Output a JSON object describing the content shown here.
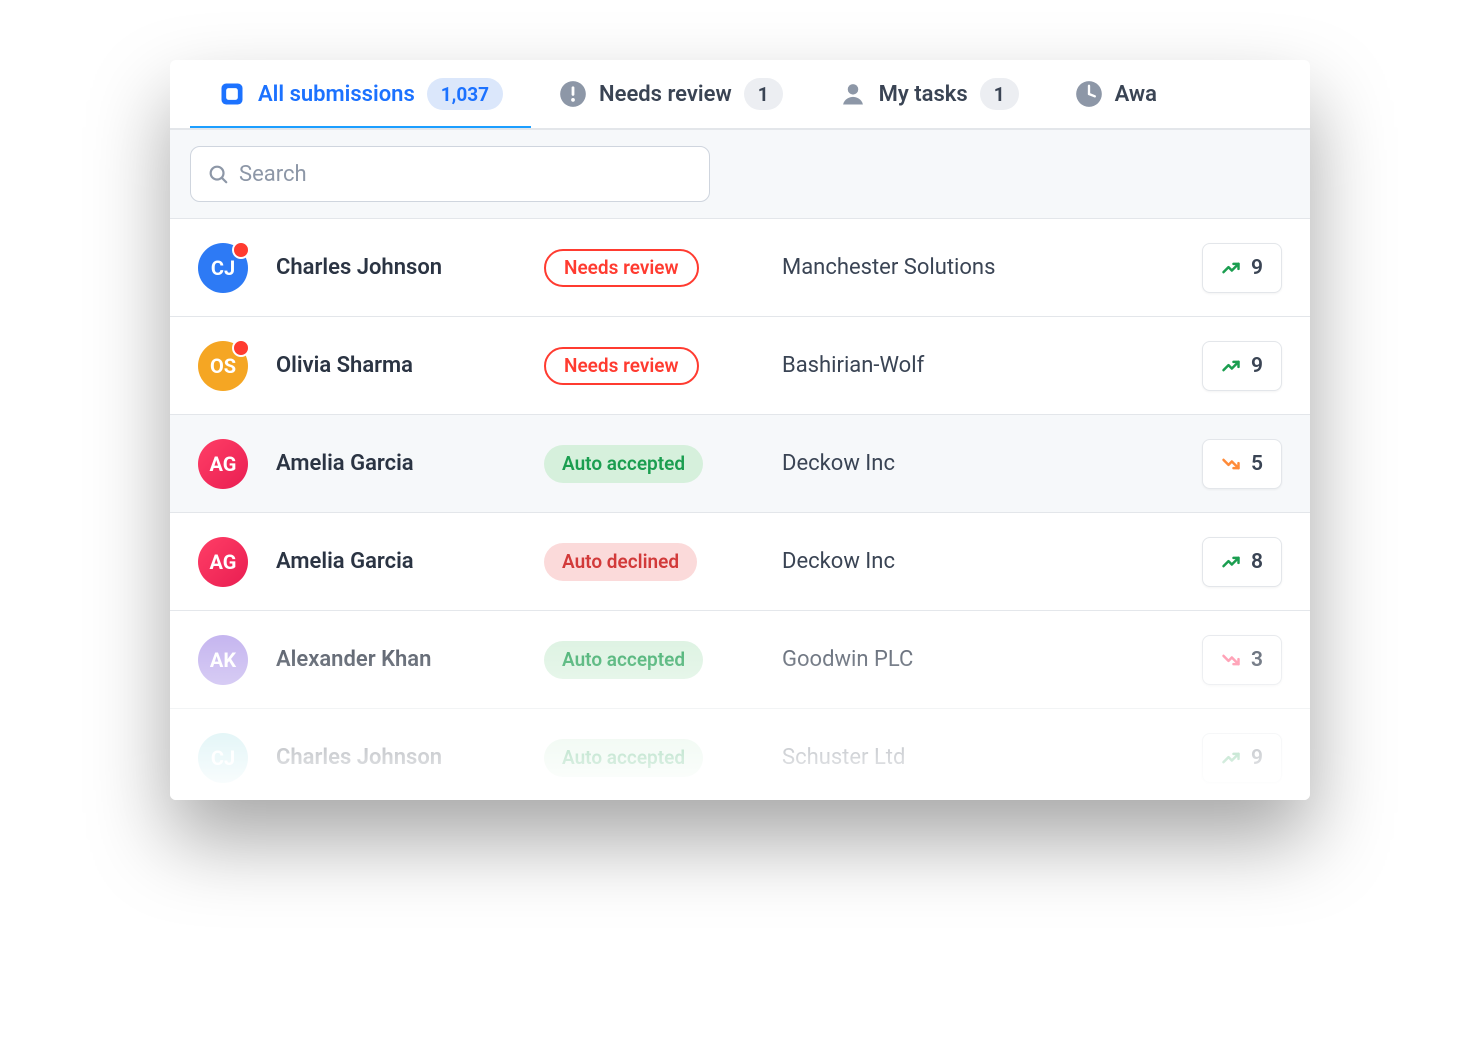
{
  "tabs": [
    {
      "icon": "inbox",
      "label": "All submissions",
      "count": "1,037",
      "active": true
    },
    {
      "icon": "alert",
      "label": "Needs review",
      "count": "1"
    },
    {
      "icon": "person",
      "label": "My tasks",
      "count": "1"
    },
    {
      "icon": "clock",
      "label": "Awa"
    }
  ],
  "search": {
    "placeholder": "Search",
    "value": ""
  },
  "rows": [
    {
      "initials": "CJ",
      "avatarColor": "c-blue",
      "dot": true,
      "name": "Charles Johnson",
      "status": "Needs review",
      "statusKind": "review",
      "company": "Manchester Solutions",
      "trend": "up",
      "score": "9",
      "alt": false
    },
    {
      "initials": "OS",
      "avatarColor": "c-amber",
      "dot": true,
      "name": "Olivia Sharma",
      "status": "Needs review",
      "statusKind": "review",
      "company": "Bashirian-Wolf",
      "trend": "up",
      "score": "9",
      "alt": false
    },
    {
      "initials": "AG",
      "avatarColor": "c-pink",
      "dot": false,
      "name": "Amelia Garcia",
      "status": "Auto accepted",
      "statusKind": "accepted",
      "company": "Deckow Inc",
      "trend": "down",
      "score": "5",
      "alt": true
    },
    {
      "initials": "AG",
      "avatarColor": "c-pink",
      "dot": false,
      "name": "Amelia Garcia",
      "status": "Auto declined",
      "statusKind": "declined",
      "company": "Deckow Inc",
      "trend": "up",
      "score": "8",
      "alt": false
    },
    {
      "initials": "AK",
      "avatarColor": "c-purple",
      "dot": false,
      "name": "Alexander Khan",
      "status": "Auto accepted",
      "statusKind": "accepted",
      "company": "Goodwin PLC",
      "trend": "down2",
      "score": "3",
      "alt": false
    },
    {
      "initials": "CJ",
      "avatarColor": "c-cyan",
      "dot": false,
      "name": "Charles Johnson",
      "status": "Auto accepted",
      "statusKind": "accepted",
      "company": "Schuster Ltd",
      "trend": "up",
      "score": "9",
      "alt": false
    }
  ]
}
